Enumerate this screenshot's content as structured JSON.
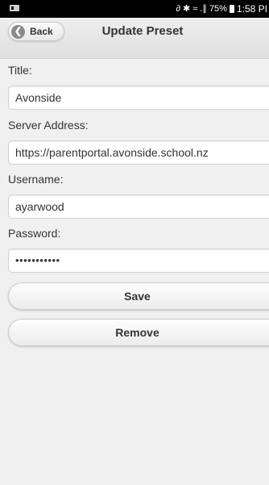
{
  "status_bar": {
    "signal_text": "∂ ✱ ≈ .∥ 75%",
    "time": "1:58 PI"
  },
  "header": {
    "back_label": "Back",
    "title": "Update Preset"
  },
  "form": {
    "title_label": "Title:",
    "title_value": "Avonside",
    "server_label": "Server Address:",
    "server_value": "https://parentportal.avonside.school.nz",
    "username_label": "Username:",
    "username_value": "ayarwood",
    "password_label": "Password:",
    "password_value": "•••••••••••"
  },
  "actions": {
    "save_label": "Save",
    "remove_label": "Remove"
  }
}
